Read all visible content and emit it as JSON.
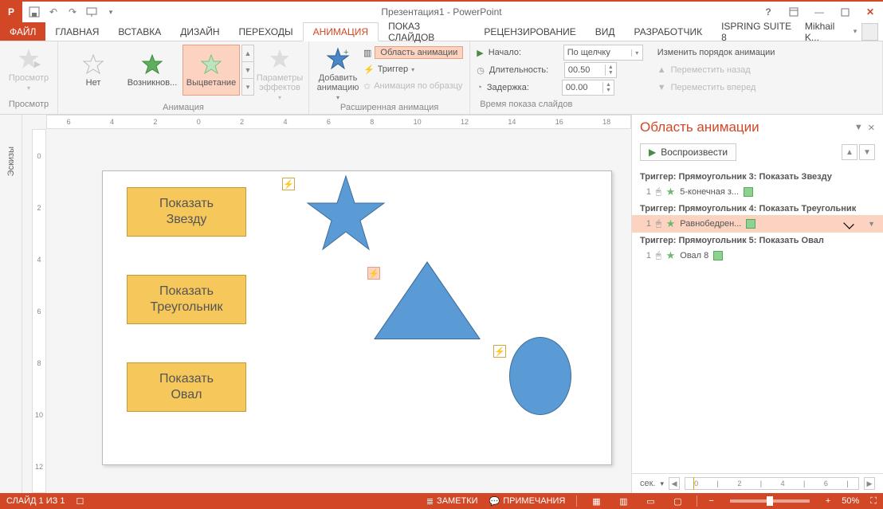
{
  "titlebar": {
    "doc_title": "Презентация1 - PowerPoint",
    "user": "Mikhail K..."
  },
  "tabs": {
    "file": "ФАЙЛ",
    "items": [
      "ГЛАВНАЯ",
      "ВСТАВКА",
      "ДИЗАЙН",
      "ПЕРЕХОДЫ",
      "АНИМАЦИЯ",
      "ПОКАЗ СЛАЙДОВ",
      "РЕЦЕНЗИРОВАНИЕ",
      "ВИД",
      "РАЗРАБОТЧИК",
      "ISPRING SUITE 8"
    ],
    "active_index": 4
  },
  "ribbon": {
    "preview": {
      "label": "Просмотр",
      "caption": "Просмотр"
    },
    "animation": {
      "caption": "Анимация",
      "items": [
        {
          "label": "Нет",
          "kind": "none"
        },
        {
          "label": "Возникнов...",
          "kind": "green"
        },
        {
          "label": "Выцветание",
          "kind": "green",
          "selected": true
        }
      ]
    },
    "options": {
      "label": "Параметры\nэффектов"
    },
    "advanced": {
      "caption": "Расширенная анимация",
      "add": "Добавить\nанимацию",
      "pane": "Область анимации",
      "trigger": "Триггер",
      "painter": "Анимация по образцу"
    },
    "timing": {
      "caption": "Время показа слайдов",
      "start_label": "Начало:",
      "start_value": "По щелчку",
      "duration_label": "Длительность:",
      "duration_value": "00.50",
      "delay_label": "Задержка:",
      "delay_value": "00.00",
      "reorder_label": "Изменить порядок анимации",
      "move_back": "Переместить назад",
      "move_fwd": "Переместить вперед"
    }
  },
  "thumbnails": {
    "label": "Эскизы"
  },
  "ruler_h": [
    "6",
    "4",
    "2",
    "0",
    "2",
    "4",
    "6",
    "8",
    "10",
    "12",
    "14",
    "16",
    "18"
  ],
  "ruler_v": [
    "0",
    "2",
    "4",
    "6",
    "8",
    "10",
    "12"
  ],
  "slide": {
    "buttons": [
      {
        "text": "Показать\nЗвезду"
      },
      {
        "text": "Показать\nТреугольник"
      },
      {
        "text": "Показать\nОвал"
      }
    ]
  },
  "anim_pane": {
    "title": "Область анимации",
    "play": "Воспроизвести",
    "groups": [
      {
        "trigger": "Триггер: Прямоугольник 3: Показать Звезду",
        "num": "1",
        "name": "5-конечная з..."
      },
      {
        "trigger": "Триггер: Прямоугольник 4: Показать Треугольник",
        "num": "1",
        "name": "Равнобедрен...",
        "selected": true
      },
      {
        "trigger": "Триггер: Прямоугольник 5: Показать Овал",
        "num": "1",
        "name": "Овал 8"
      }
    ],
    "seconds_label": "сек.",
    "ticks": [
      "0",
      "2",
      "4",
      "6"
    ]
  },
  "statusbar": {
    "slide": "СЛАЙД 1 ИЗ 1",
    "notes": "ЗАМЕТКИ",
    "comments": "ПРИМЕЧАНИЯ",
    "zoom": "50%"
  }
}
